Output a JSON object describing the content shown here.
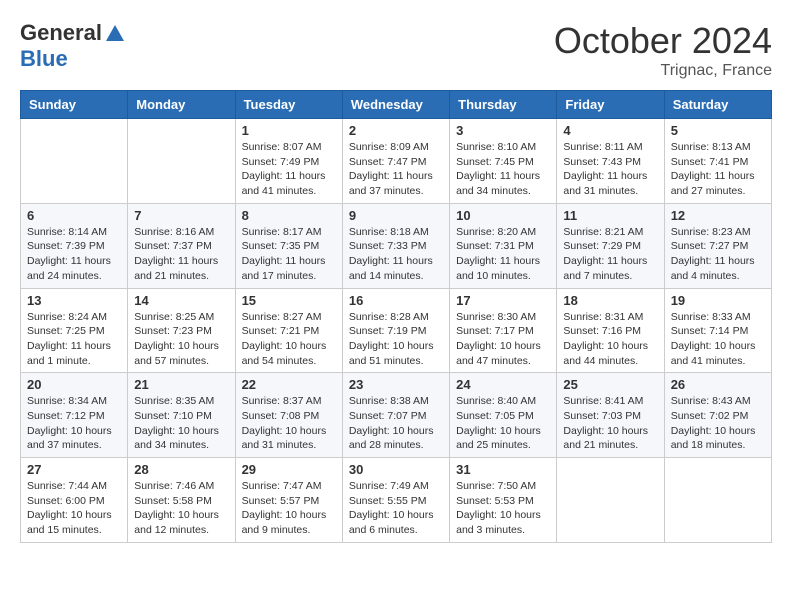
{
  "header": {
    "logo_line1": "General",
    "logo_line2": "Blue",
    "month_title": "October 2024",
    "location": "Trignac, France"
  },
  "weekdays": [
    "Sunday",
    "Monday",
    "Tuesday",
    "Wednesday",
    "Thursday",
    "Friday",
    "Saturday"
  ],
  "weeks": [
    [
      {
        "day": "",
        "sunrise": "",
        "sunset": "",
        "daylight": ""
      },
      {
        "day": "",
        "sunrise": "",
        "sunset": "",
        "daylight": ""
      },
      {
        "day": "1",
        "sunrise": "Sunrise: 8:07 AM",
        "sunset": "Sunset: 7:49 PM",
        "daylight": "Daylight: 11 hours and 41 minutes."
      },
      {
        "day": "2",
        "sunrise": "Sunrise: 8:09 AM",
        "sunset": "Sunset: 7:47 PM",
        "daylight": "Daylight: 11 hours and 37 minutes."
      },
      {
        "day": "3",
        "sunrise": "Sunrise: 8:10 AM",
        "sunset": "Sunset: 7:45 PM",
        "daylight": "Daylight: 11 hours and 34 minutes."
      },
      {
        "day": "4",
        "sunrise": "Sunrise: 8:11 AM",
        "sunset": "Sunset: 7:43 PM",
        "daylight": "Daylight: 11 hours and 31 minutes."
      },
      {
        "day": "5",
        "sunrise": "Sunrise: 8:13 AM",
        "sunset": "Sunset: 7:41 PM",
        "daylight": "Daylight: 11 hours and 27 minutes."
      }
    ],
    [
      {
        "day": "6",
        "sunrise": "Sunrise: 8:14 AM",
        "sunset": "Sunset: 7:39 PM",
        "daylight": "Daylight: 11 hours and 24 minutes."
      },
      {
        "day": "7",
        "sunrise": "Sunrise: 8:16 AM",
        "sunset": "Sunset: 7:37 PM",
        "daylight": "Daylight: 11 hours and 21 minutes."
      },
      {
        "day": "8",
        "sunrise": "Sunrise: 8:17 AM",
        "sunset": "Sunset: 7:35 PM",
        "daylight": "Daylight: 11 hours and 17 minutes."
      },
      {
        "day": "9",
        "sunrise": "Sunrise: 8:18 AM",
        "sunset": "Sunset: 7:33 PM",
        "daylight": "Daylight: 11 hours and 14 minutes."
      },
      {
        "day": "10",
        "sunrise": "Sunrise: 8:20 AM",
        "sunset": "Sunset: 7:31 PM",
        "daylight": "Daylight: 11 hours and 10 minutes."
      },
      {
        "day": "11",
        "sunrise": "Sunrise: 8:21 AM",
        "sunset": "Sunset: 7:29 PM",
        "daylight": "Daylight: 11 hours and 7 minutes."
      },
      {
        "day": "12",
        "sunrise": "Sunrise: 8:23 AM",
        "sunset": "Sunset: 7:27 PM",
        "daylight": "Daylight: 11 hours and 4 minutes."
      }
    ],
    [
      {
        "day": "13",
        "sunrise": "Sunrise: 8:24 AM",
        "sunset": "Sunset: 7:25 PM",
        "daylight": "Daylight: 11 hours and 1 minute."
      },
      {
        "day": "14",
        "sunrise": "Sunrise: 8:25 AM",
        "sunset": "Sunset: 7:23 PM",
        "daylight": "Daylight: 10 hours and 57 minutes."
      },
      {
        "day": "15",
        "sunrise": "Sunrise: 8:27 AM",
        "sunset": "Sunset: 7:21 PM",
        "daylight": "Daylight: 10 hours and 54 minutes."
      },
      {
        "day": "16",
        "sunrise": "Sunrise: 8:28 AM",
        "sunset": "Sunset: 7:19 PM",
        "daylight": "Daylight: 10 hours and 51 minutes."
      },
      {
        "day": "17",
        "sunrise": "Sunrise: 8:30 AM",
        "sunset": "Sunset: 7:17 PM",
        "daylight": "Daylight: 10 hours and 47 minutes."
      },
      {
        "day": "18",
        "sunrise": "Sunrise: 8:31 AM",
        "sunset": "Sunset: 7:16 PM",
        "daylight": "Daylight: 10 hours and 44 minutes."
      },
      {
        "day": "19",
        "sunrise": "Sunrise: 8:33 AM",
        "sunset": "Sunset: 7:14 PM",
        "daylight": "Daylight: 10 hours and 41 minutes."
      }
    ],
    [
      {
        "day": "20",
        "sunrise": "Sunrise: 8:34 AM",
        "sunset": "Sunset: 7:12 PM",
        "daylight": "Daylight: 10 hours and 37 minutes."
      },
      {
        "day": "21",
        "sunrise": "Sunrise: 8:35 AM",
        "sunset": "Sunset: 7:10 PM",
        "daylight": "Daylight: 10 hours and 34 minutes."
      },
      {
        "day": "22",
        "sunrise": "Sunrise: 8:37 AM",
        "sunset": "Sunset: 7:08 PM",
        "daylight": "Daylight: 10 hours and 31 minutes."
      },
      {
        "day": "23",
        "sunrise": "Sunrise: 8:38 AM",
        "sunset": "Sunset: 7:07 PM",
        "daylight": "Daylight: 10 hours and 28 minutes."
      },
      {
        "day": "24",
        "sunrise": "Sunrise: 8:40 AM",
        "sunset": "Sunset: 7:05 PM",
        "daylight": "Daylight: 10 hours and 25 minutes."
      },
      {
        "day": "25",
        "sunrise": "Sunrise: 8:41 AM",
        "sunset": "Sunset: 7:03 PM",
        "daylight": "Daylight: 10 hours and 21 minutes."
      },
      {
        "day": "26",
        "sunrise": "Sunrise: 8:43 AM",
        "sunset": "Sunset: 7:02 PM",
        "daylight": "Daylight: 10 hours and 18 minutes."
      }
    ],
    [
      {
        "day": "27",
        "sunrise": "Sunrise: 7:44 AM",
        "sunset": "Sunset: 6:00 PM",
        "daylight": "Daylight: 10 hours and 15 minutes."
      },
      {
        "day": "28",
        "sunrise": "Sunrise: 7:46 AM",
        "sunset": "Sunset: 5:58 PM",
        "daylight": "Daylight: 10 hours and 12 minutes."
      },
      {
        "day": "29",
        "sunrise": "Sunrise: 7:47 AM",
        "sunset": "Sunset: 5:57 PM",
        "daylight": "Daylight: 10 hours and 9 minutes."
      },
      {
        "day": "30",
        "sunrise": "Sunrise: 7:49 AM",
        "sunset": "Sunset: 5:55 PM",
        "daylight": "Daylight: 10 hours and 6 minutes."
      },
      {
        "day": "31",
        "sunrise": "Sunrise: 7:50 AM",
        "sunset": "Sunset: 5:53 PM",
        "daylight": "Daylight: 10 hours and 3 minutes."
      },
      {
        "day": "",
        "sunrise": "",
        "sunset": "",
        "daylight": ""
      },
      {
        "day": "",
        "sunrise": "",
        "sunset": "",
        "daylight": ""
      }
    ]
  ]
}
